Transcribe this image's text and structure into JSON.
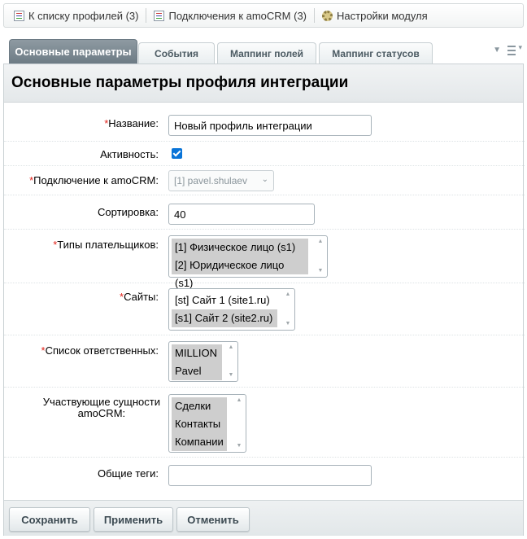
{
  "toolbar": {
    "profiles_link": "К списку профилей (3)",
    "connections_link": "Подключения к amoCRM (3)",
    "settings_link": "Настройки модуля"
  },
  "tabs": [
    {
      "label": "Основные параметры",
      "active": true
    },
    {
      "label": "События",
      "active": false
    },
    {
      "label": "Маппинг полей",
      "active": false
    },
    {
      "label": "Маппинг статусов",
      "active": false
    }
  ],
  "panel": {
    "title": "Основные параметры профиля интеграции"
  },
  "form": {
    "name": {
      "label": "Название:",
      "required": true,
      "value": "Новый профиль интеграции"
    },
    "active": {
      "label": "Активность:",
      "checked": true
    },
    "connection": {
      "label": "Подключение к amoCRM:",
      "required": true,
      "value": "[1] pavel.shulaev"
    },
    "sort": {
      "label": "Сортировка:",
      "value": "40"
    },
    "payer_types": {
      "label": "Типы плательщиков:",
      "required": true,
      "options": [
        {
          "text": "[1] Физическое лицо (s1)",
          "selected": true
        },
        {
          "text": "[2] Юридическое лицо (s1)",
          "selected": true
        }
      ]
    },
    "sites": {
      "label": "Сайты:",
      "required": true,
      "options": [
        {
          "text": "[st] Сайт 1 (site1.ru)",
          "selected": false
        },
        {
          "text": "[s1] Сайт 2 (site2.ru)",
          "selected": true
        }
      ]
    },
    "responsibles": {
      "label": "Список ответственных:",
      "required": true,
      "options": [
        {
          "text": "MILLION",
          "selected": true
        },
        {
          "text": "Pavel",
          "selected": true
        }
      ]
    },
    "entities": {
      "label_line1": "Участвующие сущности",
      "label_line2": "amoCRM:",
      "options": [
        {
          "text": "Сделки",
          "selected": true
        },
        {
          "text": "Контакты",
          "selected": true
        },
        {
          "text": "Компании",
          "selected": true
        }
      ]
    },
    "tags": {
      "label": "Общие теги:",
      "value": ""
    }
  },
  "buttons": {
    "save": "Сохранить",
    "apply": "Применить",
    "cancel": "Отменить"
  },
  "colors": {
    "required_mark": "#e2231a",
    "active_tab": "#7d8a93",
    "checkbox": "#0a74d8",
    "selected_option": "#cecece"
  }
}
